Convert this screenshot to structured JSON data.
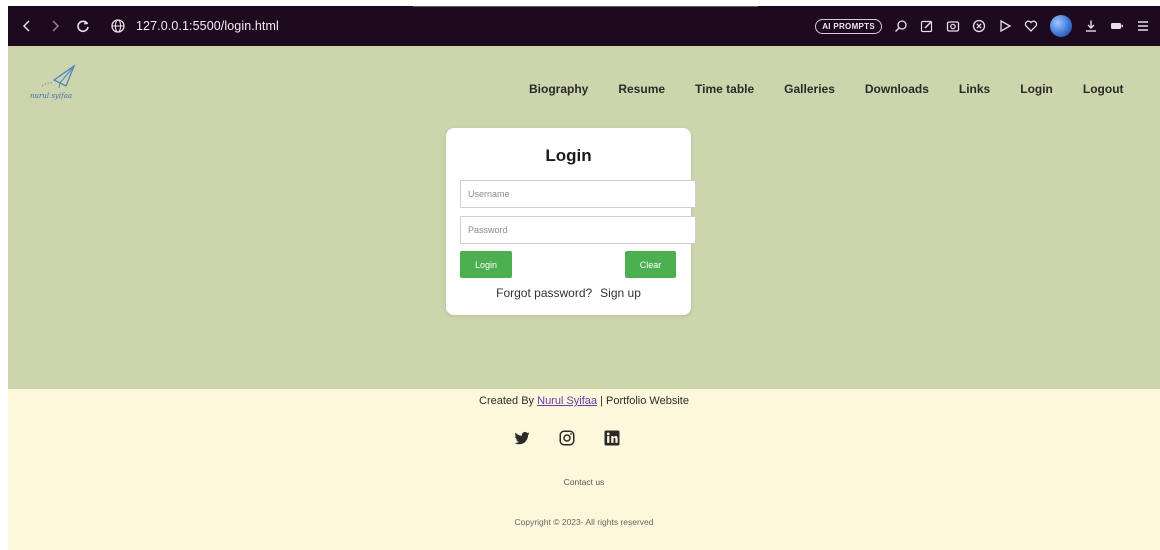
{
  "browser": {
    "url": "127.0.0.1:5500/login.html",
    "ai_pill": "AI PROMPTS"
  },
  "logo": {
    "text": "nurul syifaa"
  },
  "nav": {
    "items": [
      "Biography",
      "Resume",
      "Time table",
      "Galleries",
      "Downloads",
      "Links",
      "Login",
      "Logout"
    ]
  },
  "login": {
    "title": "Login",
    "username_placeholder": "Username",
    "password_placeholder": "Password",
    "login_button": "Login",
    "clear_button": "Clear",
    "forgot": "Forgot password?",
    "signup": "Sign up"
  },
  "footer": {
    "credit_prefix": "Created By ",
    "credit_author": "Nurul Syifaa",
    "credit_suffix": " | Portfolio Website",
    "contact": "Contact us",
    "copyright": "Copyright © 2023- All rights reserved"
  },
  "colors": {
    "chrome_bg": "#1e0a1e",
    "hero_bg": "#cdd5ad",
    "footer_bg": "#fdf8dc",
    "button_green": "#4caf50",
    "link_purple": "#6a3aa8"
  },
  "icons": {
    "back": "chevron-left-icon",
    "forward": "chevron-right-icon",
    "reload": "reload-icon",
    "site_info": "globe-icon",
    "twitter": "twitter-icon",
    "instagram": "instagram-icon",
    "linkedin": "linkedin-icon"
  }
}
